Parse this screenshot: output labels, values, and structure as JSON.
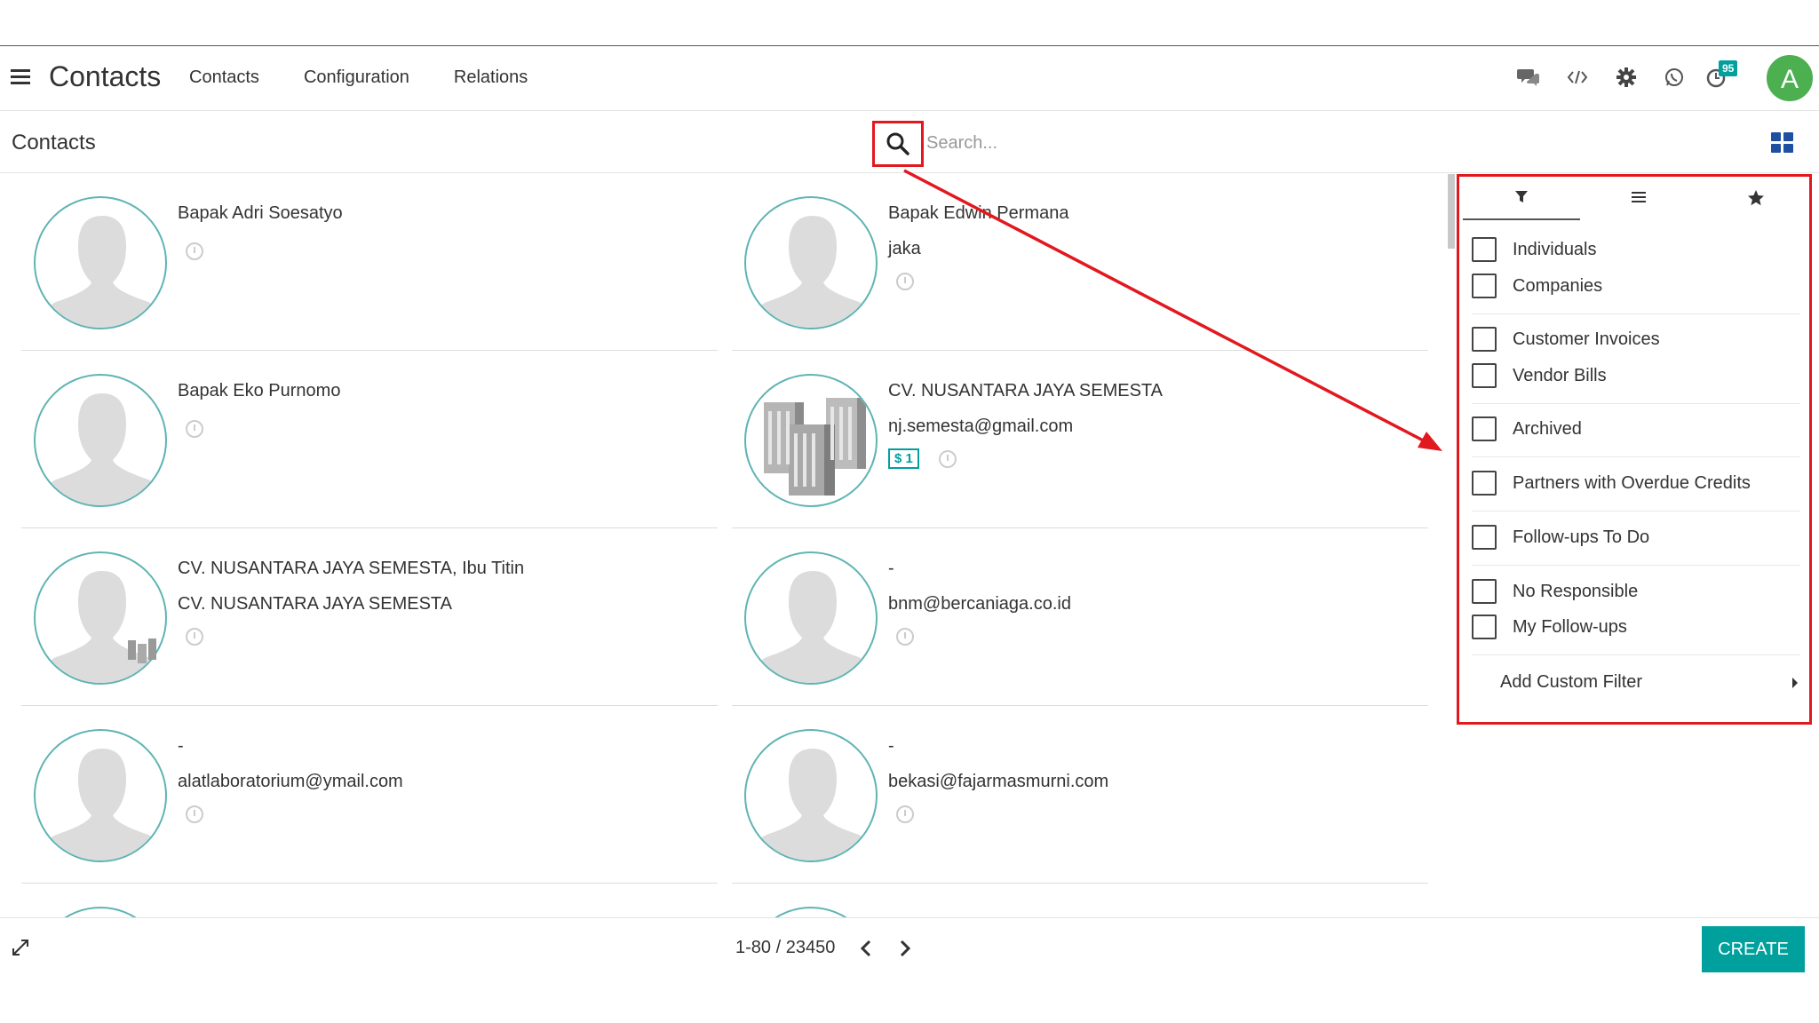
{
  "navbar": {
    "app_title": "Contacts",
    "menu": [
      "Contacts",
      "Configuration",
      "Relations"
    ],
    "activity_badge": "95",
    "avatar_letter": "A"
  },
  "control": {
    "breadcrumb": "Contacts",
    "search_placeholder": "Search..."
  },
  "cards": [
    {
      "name": "Bapak Adri Soesatyo",
      "line2": "",
      "type": "person"
    },
    {
      "name": "Bapak Edwin Permana",
      "line2": "jaka",
      "type": "person"
    },
    {
      "name": "Bapak Eko Purnomo",
      "line2": "",
      "type": "person"
    },
    {
      "name": "CV. NUSANTARA JAYA SEMESTA",
      "line2": "nj.semesta@gmail.com",
      "type": "company",
      "badge": "$ 1"
    },
    {
      "name": "CV. NUSANTARA JAYA SEMESTA, Ibu Titin",
      "line2": "CV. NUSANTARA JAYA SEMESTA",
      "type": "person-company"
    },
    {
      "name": "-",
      "line2": "bnm@bercaniaga.co.id",
      "type": "person"
    },
    {
      "name": "-",
      "line2": "alatlaboratorium@ymail.com",
      "type": "person"
    },
    {
      "name": "-",
      "line2": "bekasi@fajarmasmurni.com",
      "type": "person"
    }
  ],
  "filters": {
    "groups": [
      [
        "Individuals",
        "Companies"
      ],
      [
        "Customer Invoices",
        "Vendor Bills"
      ],
      [
        "Archived"
      ],
      [
        "Partners with Overdue Credits"
      ],
      [
        "Follow-ups To Do"
      ],
      [
        "No Responsible",
        "My Follow-ups"
      ]
    ],
    "add_custom_filter": "Add Custom Filter"
  },
  "footer": {
    "pager": "1-80 / 23450",
    "create_label": "CREATE"
  },
  "colors": {
    "accent": "#00a09d",
    "highlight": "#e2181f",
    "avatar": "#4caf50"
  }
}
